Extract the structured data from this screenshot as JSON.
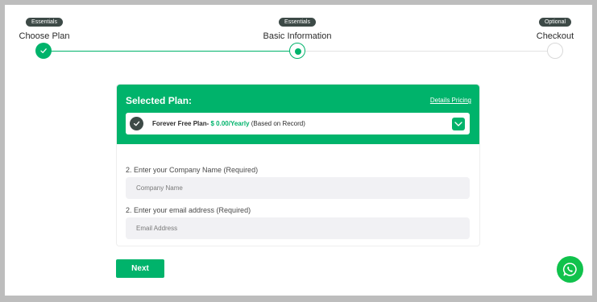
{
  "stepper": {
    "steps": [
      {
        "badge": "Essentials",
        "title": "Choose Plan",
        "state": "done"
      },
      {
        "badge": "Essentials",
        "title": "Basic Information",
        "state": "active"
      },
      {
        "badge": "Optional",
        "title": "Checkout",
        "state": "todo"
      }
    ]
  },
  "plan_card": {
    "title": "Selected Plan:",
    "details_link": "Details Pricing",
    "plan_name": "Forever Free Plan-",
    "plan_price": "$ 0.00/Yearly",
    "plan_note": "(Based on Record)"
  },
  "form": {
    "company_label": "2. Enter your Company Name (Required)",
    "company_placeholder": "Company Name",
    "email_label": "2. Enter your email address (Required)",
    "email_placeholder": "Email Address"
  },
  "actions": {
    "next_label": "Next"
  },
  "icons": {
    "step_done": "check-icon",
    "plan_selected": "check-circle-icon",
    "plan_toggle": "chevron-down-icon",
    "chat": "whatsapp-icon"
  },
  "colors": {
    "accent": "#00b36b",
    "badge": "#3d4a47",
    "whatsapp": "#10c24c",
    "frame": "#bdbdbd"
  }
}
